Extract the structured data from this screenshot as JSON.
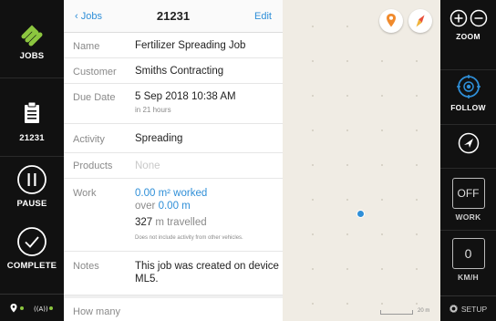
{
  "sidebar": {
    "jobs_label": "JOBS",
    "job_label": "21231",
    "pause_label": "PAUSE",
    "complete_label": "COMPLETE",
    "brand_color": "#8cc63f"
  },
  "header": {
    "back_label": "‹ Jobs",
    "title": "21231",
    "edit_label": "Edit"
  },
  "details": {
    "name_label": "Name",
    "name_value": "Fertilizer Spreading Job",
    "customer_label": "Customer",
    "customer_value": "Smiths Contracting",
    "due_label": "Due Date",
    "due_value": "5 Sep 2018 10:38 AM",
    "due_sub": "in 21 hours",
    "activity_label": "Activity",
    "activity_value": "Spreading",
    "products_label": "Products",
    "products_value": "None",
    "work_label": "Work",
    "work_area": "0.00 m² worked",
    "work_over_prefix": "over ",
    "work_over_value": "0.00 m",
    "work_travel_value": "327",
    "work_travel_suffix": " m travelled",
    "work_note": "Does not include activity from other vehicles.",
    "notes_label": "Notes",
    "notes_value": "This job was created on device ML5.",
    "how_many_label": "How many"
  },
  "map": {
    "scale_label": "20 m"
  },
  "right": {
    "zoom_label": "ZOOM",
    "follow_label": "FOLLOW",
    "work_box": "OFF",
    "work_label": "WORK",
    "speed_box": "0",
    "speed_label": "KM/H",
    "setup_label": "SETUP",
    "accent_color": "#2f8fd8"
  }
}
